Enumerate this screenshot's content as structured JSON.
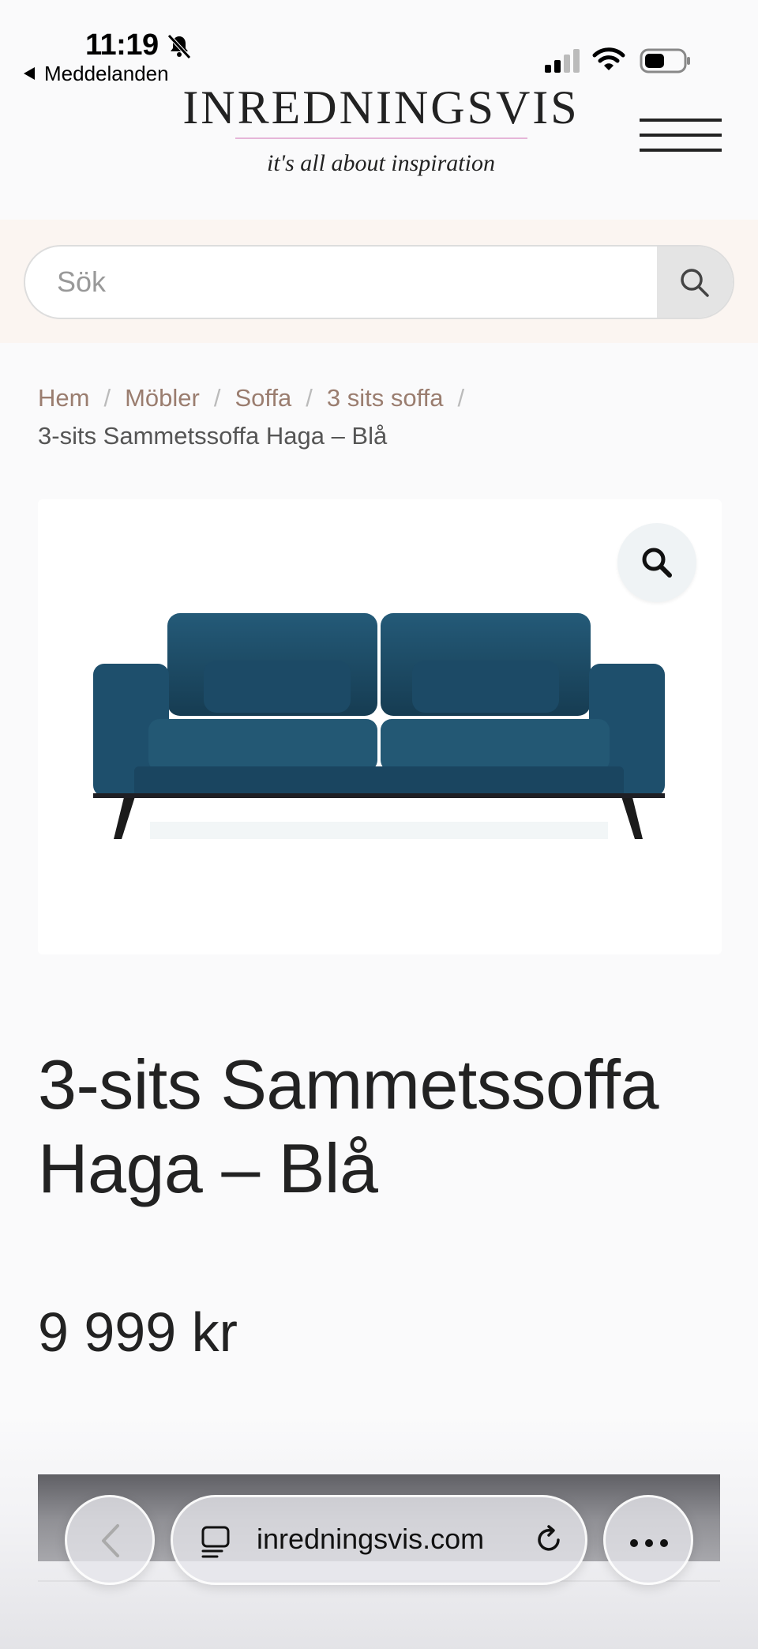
{
  "status_bar": {
    "time": "11:19",
    "back_app": "Meddelanden"
  },
  "header": {
    "logo_title": "INREDNINGSVIS",
    "logo_tagline": "it's all about inspiration",
    "menu_icon": "hamburger-menu-icon"
  },
  "search": {
    "placeholder": "Sök",
    "button_icon": "search-icon"
  },
  "breadcrumb": {
    "items": [
      "Hem",
      "Möbler",
      "Soffa",
      "3 sits soffa"
    ],
    "separator": "/",
    "current": "3-sits Sammetssoffa Haga – Blå"
  },
  "product": {
    "image_description_icon": "sofa-image",
    "zoom_icon": "magnifier-icon",
    "title": "3-sits Sammetssoffa Haga – Blå",
    "price": "9 999 kr"
  },
  "browser": {
    "address": "inredningsvis.com",
    "back_icon": "chevron-left-icon",
    "tabs_icon": "tabs-icon",
    "reload_icon": "reload-icon",
    "more_icon": "more-dots-icon"
  },
  "colors": {
    "breadcrumb_link": "#9a7d6f",
    "search_band": "#fbf5f1",
    "logo_rule": "#e6b6d8",
    "sofa": "#1d4a63",
    "dark_bar": "#202026"
  }
}
